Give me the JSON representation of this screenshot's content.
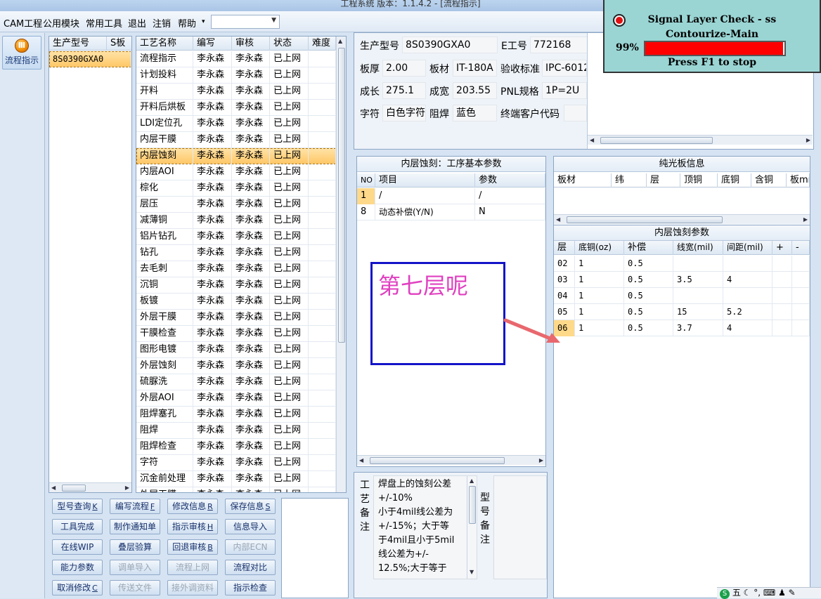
{
  "window": {
    "title": "工程系统   版本：1.1.4.2 - [流程指示]"
  },
  "menu": {
    "items": [
      "CAM工程",
      "公用模块",
      "常用工具",
      "退出",
      "注销",
      "帮助"
    ],
    "help_arrow": "▾",
    "combo_value": ""
  },
  "sidebar": {
    "flow_label": "流程指示"
  },
  "product_list": {
    "headers": [
      "生产型号",
      "S板"
    ],
    "rows": [
      [
        "8S0390GXA0",
        ""
      ]
    ]
  },
  "process_list": {
    "headers": [
      "工艺名称",
      "编写",
      "审核",
      "状态",
      "难度"
    ],
    "selected_index": 6,
    "rows": [
      [
        "流程指示",
        "李永森",
        "李永森",
        "已上网",
        ""
      ],
      [
        "计划投料",
        "李永森",
        "李永森",
        "已上网",
        ""
      ],
      [
        "开料",
        "李永森",
        "李永森",
        "已上网",
        ""
      ],
      [
        "开料后烘板",
        "李永森",
        "李永森",
        "已上网",
        ""
      ],
      [
        "LDI定位孔",
        "李永森",
        "李永森",
        "已上网",
        ""
      ],
      [
        "内层干膜",
        "李永森",
        "李永森",
        "已上网",
        ""
      ],
      [
        "内层蚀刻",
        "李永森",
        "李永森",
        "已上网",
        ""
      ],
      [
        "内层AOI",
        "李永森",
        "李永森",
        "已上网",
        ""
      ],
      [
        "棕化",
        "李永森",
        "李永森",
        "已上网",
        ""
      ],
      [
        "层压",
        "李永森",
        "李永森",
        "已上网",
        ""
      ],
      [
        "减薄铜",
        "李永森",
        "李永森",
        "已上网",
        ""
      ],
      [
        "铝片钻孔",
        "李永森",
        "李永森",
        "已上网",
        ""
      ],
      [
        "钻孔",
        "李永森",
        "李永森",
        "已上网",
        ""
      ],
      [
        "去毛刺",
        "李永森",
        "李永森",
        "已上网",
        ""
      ],
      [
        "沉铜",
        "李永森",
        "李永森",
        "已上网",
        ""
      ],
      [
        "板镀",
        "李永森",
        "李永森",
        "已上网",
        ""
      ],
      [
        "外层干膜",
        "李永森",
        "李永森",
        "已上网",
        ""
      ],
      [
        "干膜检查",
        "李永森",
        "李永森",
        "已上网",
        ""
      ],
      [
        "图形电镀",
        "李永森",
        "李永森",
        "已上网",
        ""
      ],
      [
        "外层蚀刻",
        "李永森",
        "李永森",
        "已上网",
        ""
      ],
      [
        "硫脲洗",
        "李永森",
        "李永森",
        "已上网",
        ""
      ],
      [
        "外层AOI",
        "李永森",
        "李永森",
        "已上网",
        ""
      ],
      [
        "阻焊塞孔",
        "李永森",
        "李永森",
        "已上网",
        ""
      ],
      [
        "阻焊",
        "李永森",
        "李永森",
        "已上网",
        ""
      ],
      [
        "阻焊检查",
        "李永森",
        "李永森",
        "已上网",
        ""
      ],
      [
        "字符",
        "李永森",
        "李永森",
        "已上网",
        ""
      ],
      [
        "沉金前处理",
        "李永森",
        "李永森",
        "已上网",
        ""
      ],
      [
        "外层干膜",
        "李永森",
        "李永森",
        "已上网",
        ""
      ]
    ]
  },
  "buttons": [
    [
      "型号查询",
      "K"
    ],
    [
      "编写流程",
      "F"
    ],
    [
      "修改信息",
      "R"
    ],
    [
      "保存信息",
      "S"
    ],
    [
      "工具完成",
      ""
    ],
    [
      "制作通知单",
      ""
    ],
    [
      "指示审核",
      "H"
    ],
    [
      "信息导入",
      ""
    ],
    [
      "在线WIP",
      ""
    ],
    [
      "叠层验算",
      ""
    ],
    [
      "回退审核",
      "B"
    ],
    [
      "内部ECN",
      ""
    ],
    [
      "能力参数",
      ""
    ],
    [
      "调单导入",
      ""
    ],
    [
      "流程上网",
      ""
    ],
    [
      "流程对比",
      ""
    ],
    [
      "取消修改",
      "C"
    ],
    [
      "传送文件",
      ""
    ],
    [
      "接外调资料",
      ""
    ],
    [
      "指示检查",
      ""
    ]
  ],
  "disabled_buttons": [
    11,
    13,
    14,
    17,
    18
  ],
  "info": {
    "product_label": "生产型号",
    "product_value": "8S0390GXA0",
    "e_label": "E工号",
    "e_value": "772168",
    "thickness_label": "板厚",
    "thickness_value": "2.00",
    "material_label": "板材",
    "material_value": "IT-180A",
    "standard_label": "验收标准",
    "standard_value": "IPC-6012",
    "length_label": "成长",
    "length_value": "275.1",
    "width_label": "成宽",
    "width_value": "203.55",
    "pnl_label": "PNL规格",
    "pnl_value": "1P=2U",
    "char_label": "字符",
    "char_value": "白色字符",
    "mask_label": "阻焊",
    "mask_value": "蓝色",
    "customer_label": "终端客户代码",
    "customer_value": ""
  },
  "basic_params": {
    "title": "内层蚀刻：工序基本参数",
    "headers": [
      "NO",
      "项目",
      "参数"
    ],
    "rows": [
      [
        "1",
        "/",
        "/"
      ],
      [
        "8",
        "动态补偿(Y/N)",
        "N"
      ]
    ]
  },
  "laminate": {
    "title": "纯光板信息",
    "headers": [
      "板材",
      "纬",
      "层",
      "顶铜",
      "底铜",
      "含铜",
      "板mm"
    ]
  },
  "etch_params": {
    "title": "内层蚀刻参数",
    "headers": [
      "层",
      "底铜(oz)",
      "补偿",
      "线宽(mil)",
      "间距(mil)",
      "+",
      "-"
    ],
    "rows": [
      [
        "02",
        "1",
        "0.5",
        "",
        "",
        "",
        ""
      ],
      [
        "03",
        "1",
        "0.5",
        "3.5",
        "4",
        "",
        ""
      ],
      [
        "04",
        "1",
        "0.5",
        "",
        "",
        "",
        ""
      ],
      [
        "05",
        "1",
        "0.5",
        "15",
        "5.2",
        "",
        ""
      ],
      [
        "06",
        "1",
        "0.5",
        "3.7",
        "4",
        "",
        ""
      ]
    ]
  },
  "remark": {
    "label_chars": [
      "工",
      "艺",
      "备",
      "注"
    ],
    "lines": [
      "焊盘上的蚀刻公差",
      "+/-10%",
      "小于4mil线公差为",
      "+/-15%；大于等",
      "于4mil且小于5mil",
      "线公差为+/-",
      "12.5%;大于等于"
    ],
    "model_label_chars": [
      "型",
      "号",
      "备",
      "注"
    ]
  },
  "popup": {
    "line1": "Signal Layer Check - ss",
    "line2": "Contourize-Main",
    "percent_text": "99%",
    "progress": 0.99,
    "footer": "Press F1 to stop"
  },
  "annotation": {
    "text": "第七层呢"
  },
  "tray": {
    "ime": "五",
    "icons": [
      "moon-icon",
      "dot-icon",
      "keyboard-icon",
      "person-icon",
      "wrench-icon"
    ]
  }
}
